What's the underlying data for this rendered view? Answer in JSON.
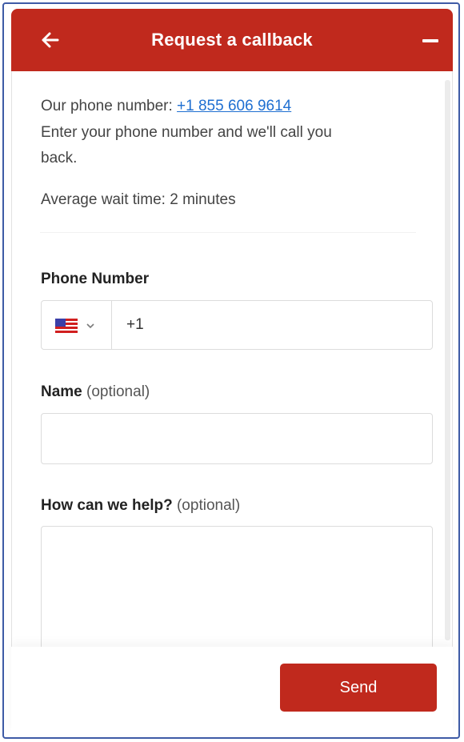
{
  "header": {
    "title": "Request a callback",
    "back_icon": "arrow-left-icon",
    "minimize_icon": "minus-icon",
    "background": "#c0291d"
  },
  "info": {
    "phone_prefix": "Our phone number: ",
    "phone_link": "+1 855 606 9614",
    "line2": "Enter your phone number and we'll call you",
    "line3": "back.",
    "wait_time": "Average wait time: 2 minutes"
  },
  "form": {
    "phone_label": "Phone Number",
    "phone_country_icon": "us-flag-icon",
    "phone_value": "+1",
    "name_label": "Name",
    "name_optional": "(optional)",
    "name_value": "",
    "help_label": "How can we help?",
    "help_optional": "(optional)",
    "help_value": ""
  },
  "footer": {
    "send_label": "Send"
  }
}
